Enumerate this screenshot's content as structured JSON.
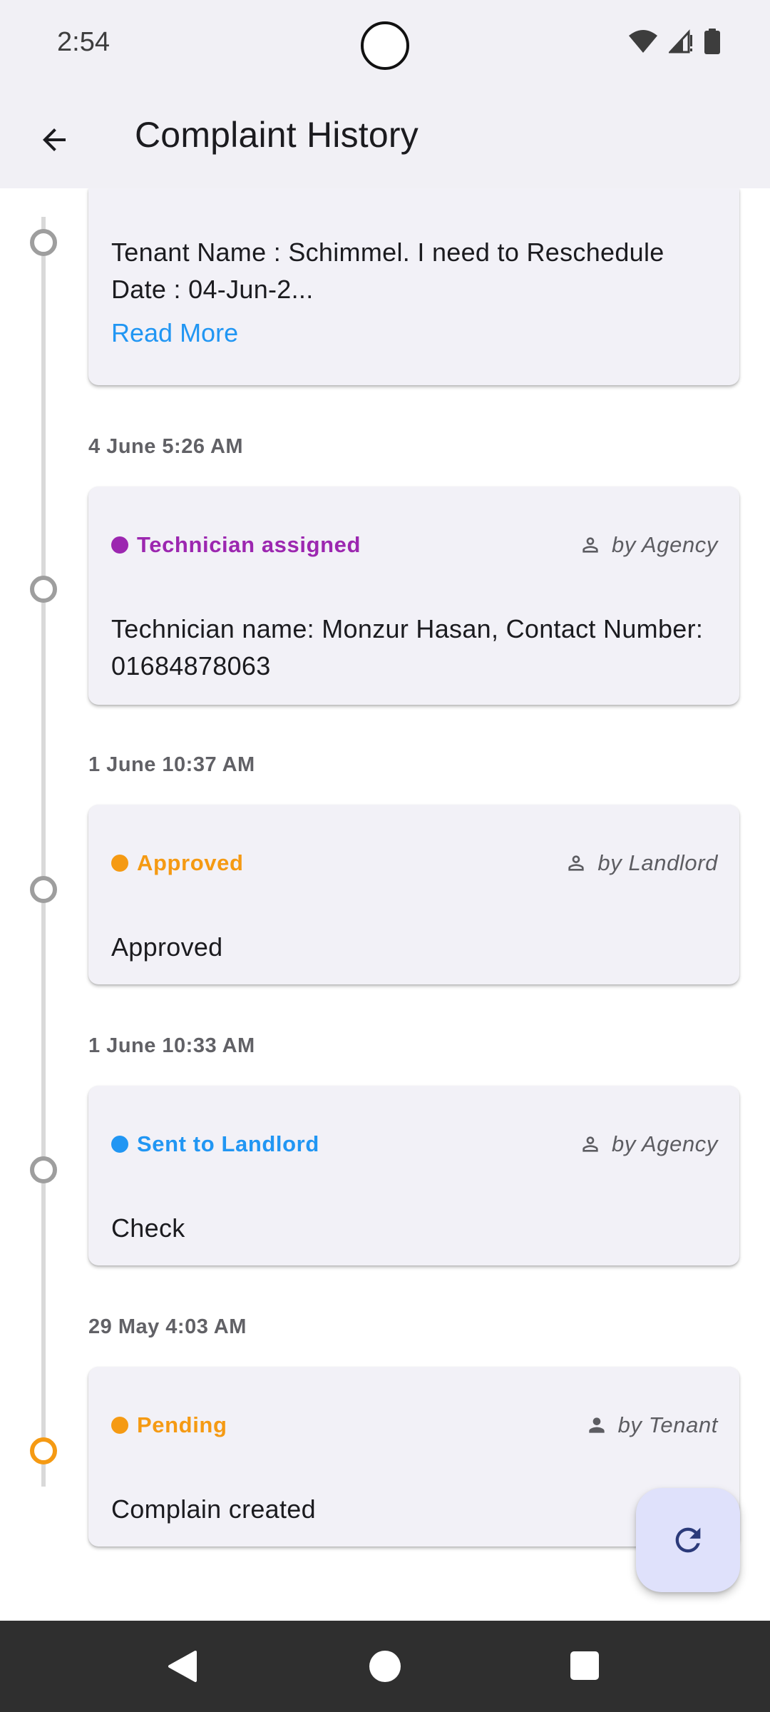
{
  "status_bar": {
    "time": "2:54"
  },
  "app_bar": {
    "title": "Complaint History"
  },
  "entries": [
    {
      "body": "Tenant Name : Schimmel. I need to Reschedule Date : 04-Jun-2...",
      "read_more": "Read More"
    },
    {
      "date": "4 June 5:26 AM",
      "status": "Technician assigned",
      "status_color": "#9c27b0",
      "by": "by Agency",
      "body": "Technician name: Monzur Hasan, Contact Number: 01684878063"
    },
    {
      "date": "1 June 10:37 AM",
      "status": "Approved",
      "status_color": "#f59a13",
      "by": "by Landlord",
      "body": "Approved"
    },
    {
      "date": "1 June 10:33 AM",
      "status": "Sent to Landlord",
      "status_color": "#2196f3",
      "by": "by Agency",
      "body": "Check"
    },
    {
      "date": "29 May 4:03 AM",
      "status": "Pending",
      "status_color": "#f59a13",
      "by": "by Tenant",
      "body": "Complain created"
    }
  ],
  "colors": {
    "accent_link": "#2196f3",
    "timeline_active": "#f59a13",
    "timeline_inactive": "#9e9e9e"
  },
  "icons": {
    "back": "arrow-back-icon",
    "person": "person-icon",
    "refresh": "refresh-icon"
  }
}
